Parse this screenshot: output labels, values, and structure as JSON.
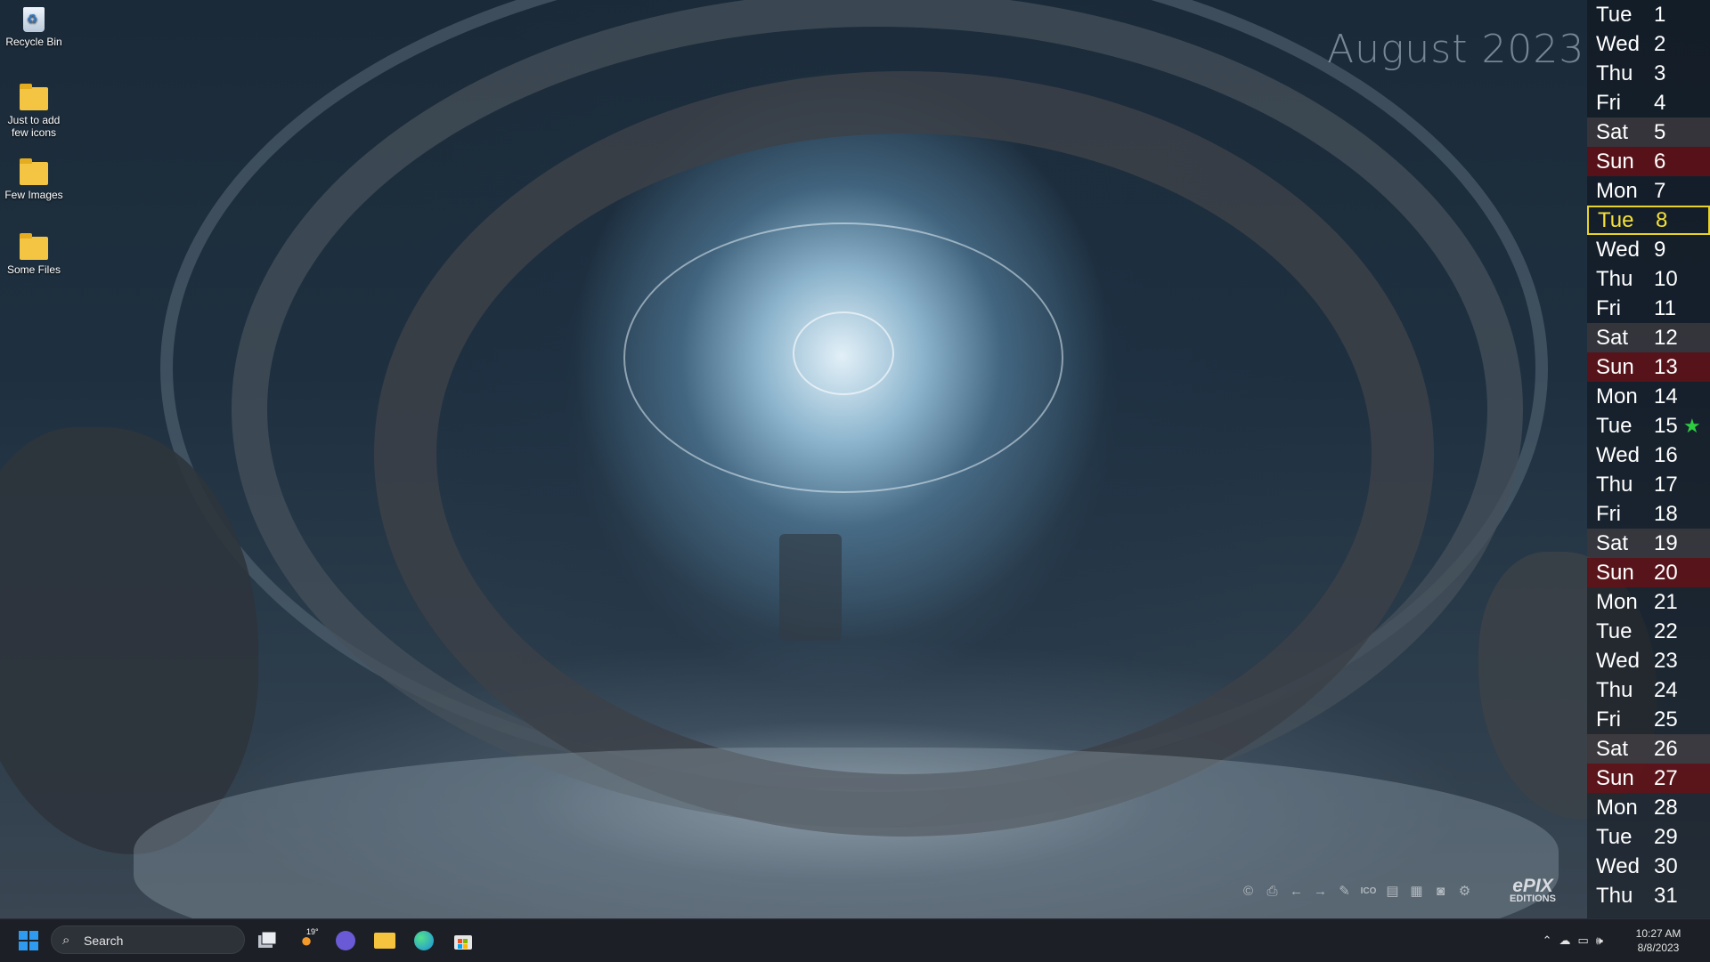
{
  "desktop": {
    "icons": [
      {
        "label": "Recycle Bin",
        "icon": "recycle-bin-icon"
      },
      {
        "label": "Just to add few icons",
        "icon": "folder-icon"
      },
      {
        "label": "Few Images",
        "icon": "folder-icon"
      },
      {
        "label": "Some Files",
        "icon": "folder-icon"
      }
    ]
  },
  "calendar": {
    "title": "August 2023",
    "today": 8,
    "starred": 15,
    "days": [
      {
        "name": "Tue",
        "date": "1"
      },
      {
        "name": "Wed",
        "date": "2"
      },
      {
        "name": "Thu",
        "date": "3"
      },
      {
        "name": "Fri",
        "date": "4"
      },
      {
        "name": "Sat",
        "date": "5"
      },
      {
        "name": "Sun",
        "date": "6"
      },
      {
        "name": "Mon",
        "date": "7"
      },
      {
        "name": "Tue",
        "date": "8"
      },
      {
        "name": "Wed",
        "date": "9"
      },
      {
        "name": "Thu",
        "date": "10"
      },
      {
        "name": "Fri",
        "date": "11"
      },
      {
        "name": "Sat",
        "date": "12"
      },
      {
        "name": "Sun",
        "date": "13"
      },
      {
        "name": "Mon",
        "date": "14"
      },
      {
        "name": "Tue",
        "date": "15"
      },
      {
        "name": "Wed",
        "date": "16"
      },
      {
        "name": "Thu",
        "date": "17"
      },
      {
        "name": "Fri",
        "date": "18"
      },
      {
        "name": "Sat",
        "date": "19"
      },
      {
        "name": "Sun",
        "date": "20"
      },
      {
        "name": "Mon",
        "date": "21"
      },
      {
        "name": "Tue",
        "date": "22"
      },
      {
        "name": "Wed",
        "date": "23"
      },
      {
        "name": "Thu",
        "date": "24"
      },
      {
        "name": "Fri",
        "date": "25"
      },
      {
        "name": "Sat",
        "date": "26"
      },
      {
        "name": "Sun",
        "date": "27"
      },
      {
        "name": "Mon",
        "date": "28"
      },
      {
        "name": "Tue",
        "date": "29"
      },
      {
        "name": "Wed",
        "date": "30"
      },
      {
        "name": "Thu",
        "date": "31"
      }
    ],
    "colors": {
      "today": "#f5e03a",
      "sunday": "#6e0f14",
      "star": "#2ecc40"
    }
  },
  "toolbar": {
    "icons": [
      "copyright-icon",
      "print-icon",
      "arrow-left-icon",
      "arrow-right-icon",
      "brush-icon",
      "ico-icon",
      "document-icon",
      "grid-icon",
      "camera-icon",
      "gear-icon"
    ]
  },
  "brand": {
    "line1": "ePIX",
    "line2": "EDITIONS"
  },
  "taskbar": {
    "search_placeholder": "Search",
    "weather_temp": "19°",
    "pinned": [
      "start-icon",
      "task-view-icon",
      "weather-icon",
      "teams-icon",
      "file-explorer-icon",
      "edge-icon",
      "store-icon"
    ],
    "time": "10:27 AM",
    "date": "8/8/2023"
  }
}
